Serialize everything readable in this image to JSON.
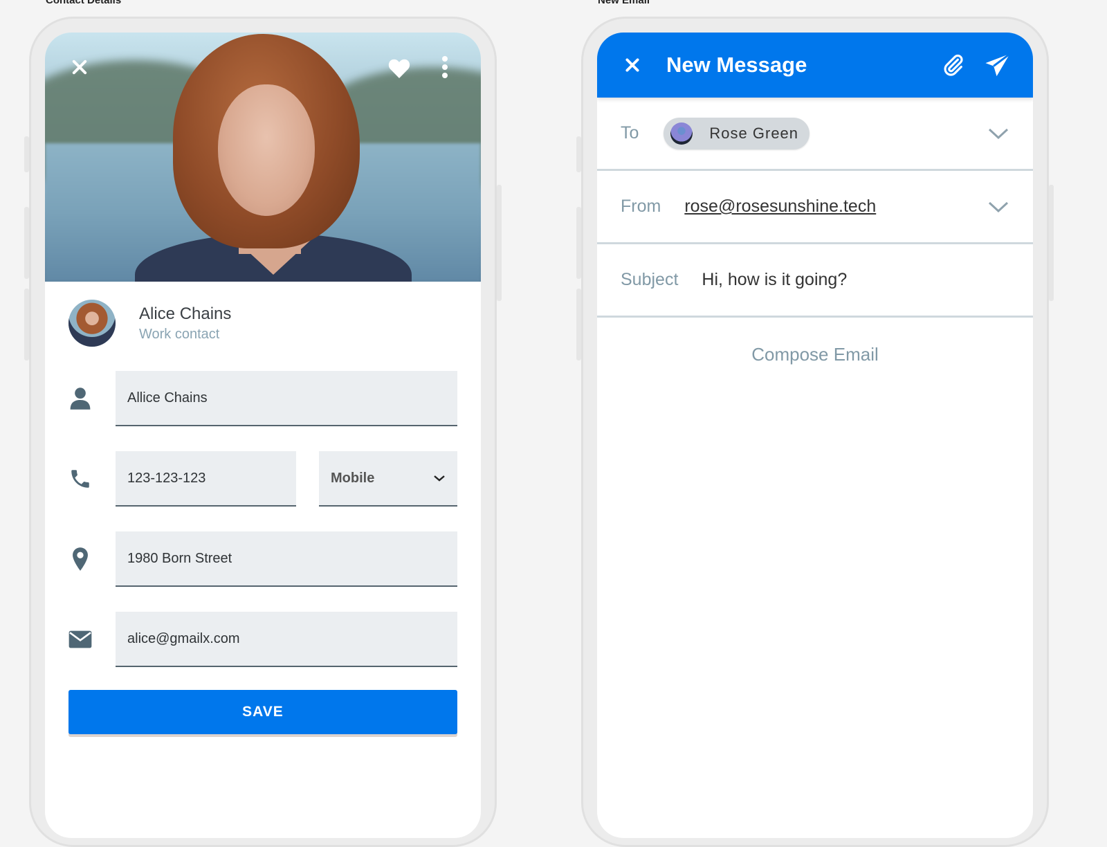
{
  "captions": {
    "left": "Contact Details",
    "right": "New Email"
  },
  "contact": {
    "header_icons": {
      "close": "close-icon",
      "favorite": "heart-icon",
      "more": "more-vertical-icon"
    },
    "profile": {
      "name": "Alice Chains",
      "subtitle": "Work contact"
    },
    "fields": {
      "name": {
        "icon": "person-icon",
        "value": "Allice Chains"
      },
      "phone": {
        "icon": "phone-icon",
        "value": "123-123-123"
      },
      "phone_type": {
        "selected": "Mobile"
      },
      "address": {
        "icon": "location-pin-icon",
        "value": "1980 Born Street"
      },
      "email": {
        "icon": "mail-icon",
        "value": "alice@gmailx.com"
      }
    },
    "save_label": "SAVE",
    "colors": {
      "accent": "#0077ec"
    }
  },
  "email": {
    "title": "New Message",
    "icons": {
      "close": "close-icon",
      "attach": "paperclip-icon",
      "send": "send-icon"
    },
    "to": {
      "label": "To",
      "recipient": "Rose Green"
    },
    "from": {
      "label": "From",
      "value": "rose@rosesunshine.tech"
    },
    "subject": {
      "label": "Subject",
      "value": "Hi, how is it going?"
    },
    "body_placeholder": "Compose Email",
    "colors": {
      "header": "#0077ec"
    }
  }
}
